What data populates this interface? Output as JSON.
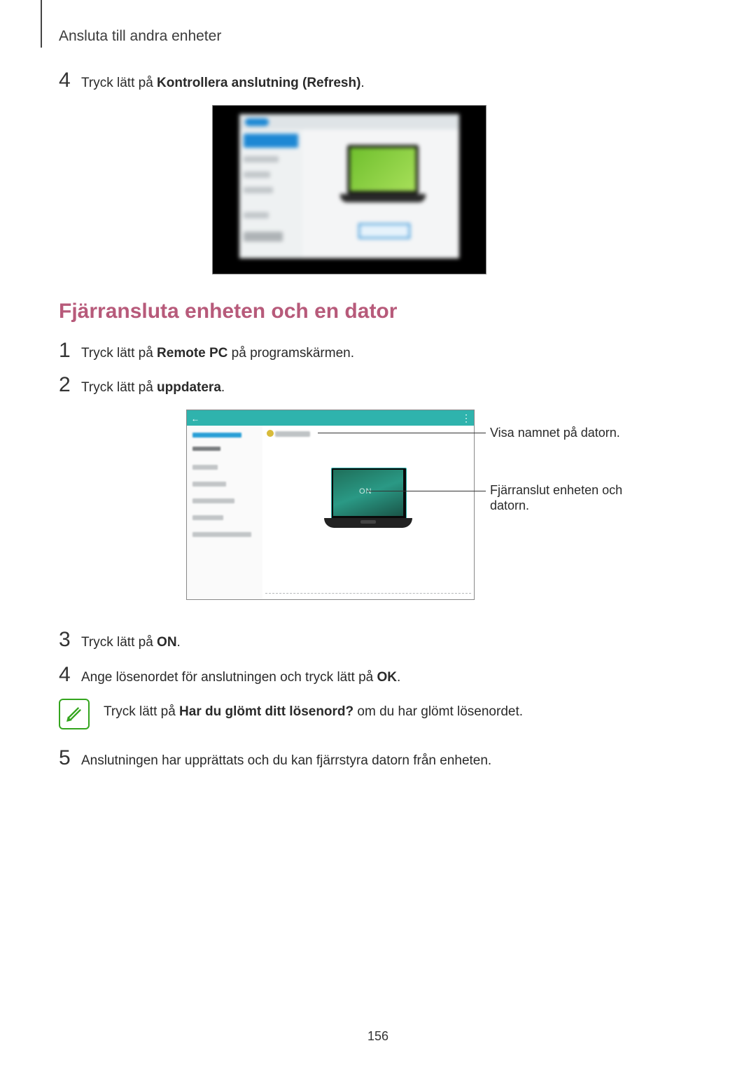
{
  "header": "Ansluta till andra enheter",
  "step4a_prefix": "Tryck lätt på ",
  "step4a_bold": "Kontrollera anslutning (Refresh)",
  "step4a_suffix": ".",
  "heading": "Fjärransluta enheten och en dator",
  "step1_prefix": "Tryck lätt på ",
  "step1_bold": "Remote PC",
  "step1_suffix": " på programskärmen.",
  "step2_prefix": "Tryck lätt på ",
  "step2_bold": "uppdatera",
  "step2_suffix": ".",
  "callout1": "Visa namnet på datorn.",
  "callout2": "Fjärranslut enheten och datorn.",
  "on_label": "ON",
  "step3_prefix": "Tryck lätt på ",
  "step3_bold": "ON",
  "step3_suffix": ".",
  "step4b_prefix": "Ange lösenordet för anslutningen och tryck lätt på ",
  "step4b_bold": "OK",
  "step4b_suffix": ".",
  "note_prefix": "Tryck lätt på ",
  "note_bold": "Har du glömt ditt lösenord?",
  "note_suffix": " om du har glömt lösenordet.",
  "step5": "Anslutningen har upprättats och du kan fjärrstyra datorn från enheten.",
  "page_number": "156",
  "nums": {
    "n4": "4",
    "n1": "1",
    "n2": "2",
    "n3": "3",
    "n5": "5"
  }
}
